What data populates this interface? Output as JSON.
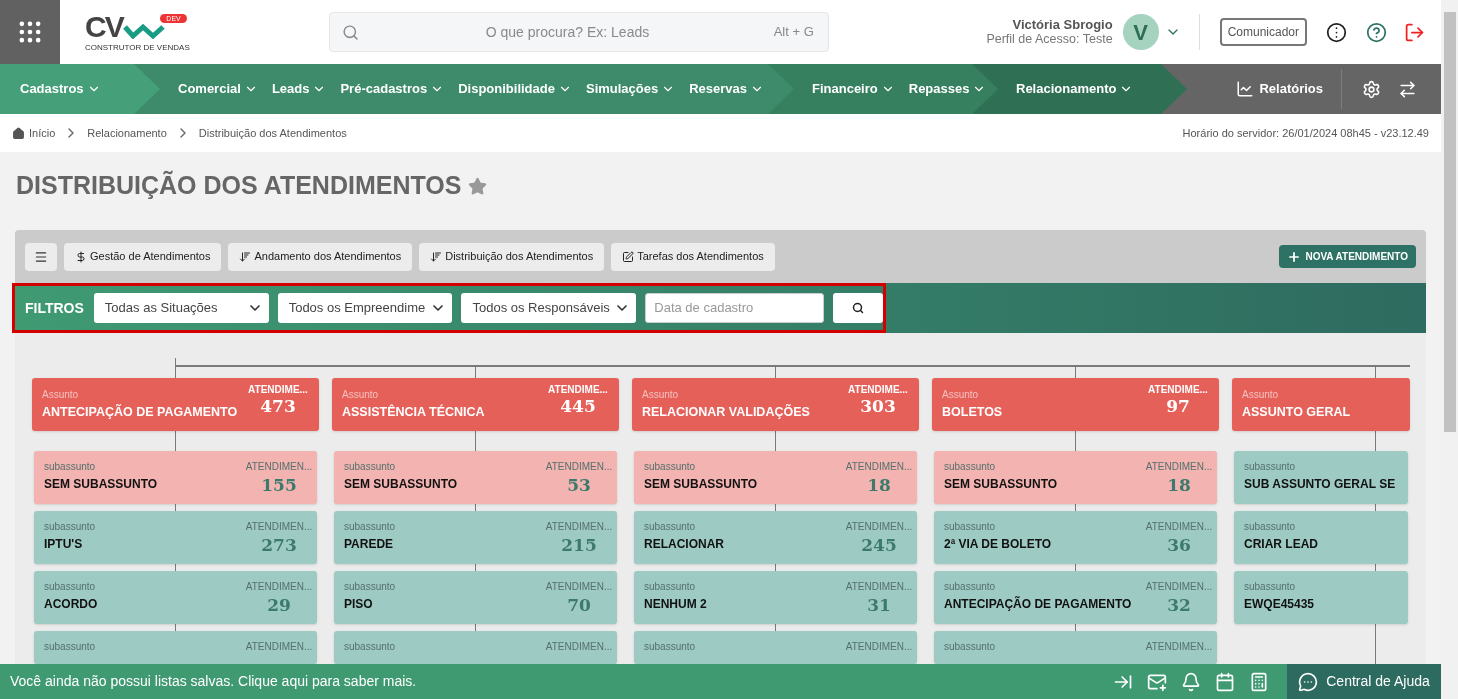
{
  "logo": {
    "mark": "CV",
    "badge": "DEV",
    "tagline": "CONSTRUTOR DE VENDAS"
  },
  "search": {
    "placeholder": "O que procura? Ex: Leads",
    "shortcut": "Alt + G"
  },
  "user": {
    "name": "Victória Sbrogio",
    "profile": "Perfil de Acesso: Teste",
    "initial": "V"
  },
  "header_buttons": {
    "communicator": "Comunicador"
  },
  "nav": {
    "groups": [
      {
        "items": [
          "Cadastros"
        ]
      },
      {
        "items": [
          "Comercial",
          "Leads",
          "Pré-cadastros",
          "Disponibilidade",
          "Simulações",
          "Reservas"
        ]
      },
      {
        "items": [
          "Financeiro",
          "Repasses"
        ]
      },
      {
        "items": [
          "Relacionamento"
        ]
      }
    ],
    "reports": "Relatórios"
  },
  "breadcrumb": [
    "Início",
    "Relacionamento",
    "Distribuição dos Atendimentos"
  ],
  "server_time": "Horário do servidor: 26/01/2024 08h45 - v23.12.49",
  "title": "DISTRIBUIÇÃO DOS ATENDIMENTOS",
  "toolbar": [
    {
      "kind": "money",
      "label": "Gestão de Atendimentos"
    },
    {
      "kind": "sort",
      "label": "Andamento dos Atendimentos"
    },
    {
      "kind": "sort",
      "label": "Distribuição dos Atendimentos"
    },
    {
      "kind": "edit",
      "label": "Tarefas dos Atendimentos"
    }
  ],
  "new_button": "NOVA ATENDIMENTO",
  "filters": {
    "label": "FILTROS",
    "selects": [
      "Todas as Situações",
      "Todos os Empreendime",
      "Todos os Responsáveis"
    ],
    "date_placeholder": "Data de cadastro"
  },
  "board": {
    "columns": [
      {
        "label": "Assunto",
        "name": "ANTECIPAÇÃO DE PAGAMENTO",
        "count_label": "ATENDIME...",
        "count": "473",
        "subjects": [
          {
            "label": "subassunto",
            "name": "SEM SUBASSUNTO",
            "count_label": "ATENDIMEN...",
            "count": "155",
            "color": "#f2b3b1"
          },
          {
            "label": "subassunto",
            "name": "IPTU'S",
            "count_label": "ATENDIMEN...",
            "count": "273",
            "color": "#9ecac4"
          },
          {
            "label": "subassunto",
            "name": "ACORDO",
            "count_label": "ATENDIMEN...",
            "count": "29",
            "color": "#9ecac4"
          },
          {
            "label": "subassunto",
            "count_label": "ATENDIMEN...",
            "color": "#9ecac4"
          }
        ]
      },
      {
        "label": "Assunto",
        "name": "ASSISTÊNCIA TÉCNICA",
        "count_label": "ATENDIME...",
        "count": "445",
        "subjects": [
          {
            "label": "subassunto",
            "name": "SEM SUBASSUNTO",
            "count_label": "ATENDIMEN...",
            "count": "53",
            "color": "#f2b3b1"
          },
          {
            "label": "subassunto",
            "name": "PAREDE",
            "count_label": "ATENDIMEN...",
            "count": "215",
            "color": "#9ecac4"
          },
          {
            "label": "subassunto",
            "name": "PISO",
            "count_label": "ATENDIMEN...",
            "count": "70",
            "color": "#9ecac4"
          },
          {
            "label": "subassunto",
            "count_label": "ATENDIMEN...",
            "color": "#9ecac4"
          }
        ]
      },
      {
        "label": "Assunto",
        "name": "RELACIONAR VALIDAÇÕES",
        "count_label": "ATENDIME...",
        "count": "303",
        "subjects": [
          {
            "label": "subassunto",
            "name": "SEM SUBASSUNTO",
            "count_label": "ATENDIMEN...",
            "count": "18",
            "color": "#f2b3b1"
          },
          {
            "label": "subassunto",
            "name": "RELACIONAR",
            "count_label": "ATENDIMEN...",
            "count": "245",
            "color": "#9ecac4"
          },
          {
            "label": "subassunto",
            "name": "NENHUM 2",
            "count_label": "ATENDIMEN...",
            "count": "31",
            "color": "#9ecac4"
          },
          {
            "label": "subassunto",
            "count_label": "ATENDIMEN...",
            "color": "#9ecac4"
          }
        ]
      },
      {
        "label": "Assunto",
        "name": "BOLETOS",
        "count_label": "ATENDIME...",
        "count": "97",
        "subjects": [
          {
            "label": "subassunto",
            "name": "SEM SUBASSUNTO",
            "count_label": "ATENDIMEN...",
            "count": "18",
            "color": "#f2b3b1"
          },
          {
            "label": "subassunto",
            "name": "2ª VIA DE BOLETO",
            "count_label": "ATENDIMEN...",
            "count": "36",
            "color": "#9ecac4"
          },
          {
            "label": "subassunto",
            "name": "ANTECIPAÇÃO DE PAGAMENTO",
            "count_label": "ATENDIMEN...",
            "count": "32",
            "color": "#9ecac4"
          },
          {
            "label": "subassunto",
            "count_label": "ATENDIMEN...",
            "color": "#9ecac4"
          }
        ]
      },
      {
        "label": "Assunto",
        "name": "ASSUNTO GERAL",
        "subjects": [
          {
            "label": "subassunto",
            "name": "SUB ASSUNTO GERAL SE",
            "color": "#9ecac4"
          },
          {
            "label": "subassunto",
            "name": "CRIAR LEAD",
            "color": "#9ecac4"
          },
          {
            "label": "subassunto",
            "name": "EWQE45435",
            "color": "#9ecac4"
          }
        ]
      }
    ]
  },
  "footer": {
    "message": "Você ainda não possui listas salvas. Clique aqui para saber mais.",
    "help": "Central de Ajuda"
  }
}
